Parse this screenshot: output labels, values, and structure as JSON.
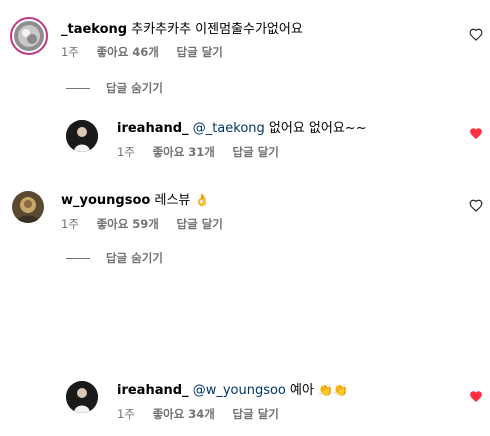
{
  "comments": [
    {
      "username": "_taekong",
      "text": "추카추카추 이젠멈출수가없어요",
      "time": "1주",
      "likes": "좋아요 46개",
      "reply": "답글 달기",
      "liked": false,
      "avatar_icon": "globe-avatar"
    },
    {
      "username": "ireahand_",
      "mention": "@_taekong",
      "text": "없어요 없어요~~",
      "time": "1주",
      "likes": "좋아요 31개",
      "reply": "답글 달기",
      "liked": true,
      "avatar_icon": "portrait-avatar"
    },
    {
      "username": "w_youngsoo",
      "text": "레스뷰",
      "emoji": "👌",
      "time": "1주",
      "likes": "좋아요 59개",
      "reply": "답글 달기",
      "liked": false,
      "avatar_icon": "person-avatar"
    },
    {
      "username": "ireahand_",
      "mention": "@w_youngsoo",
      "text": "예아",
      "emoji": "👏👏",
      "time": "1주",
      "likes": "좋아요 34개",
      "reply": "답글 달기",
      "liked": true,
      "avatar_icon": "portrait-avatar"
    }
  ],
  "toggles": [
    {
      "label": "답글 숨기기"
    },
    {
      "label": "답글 숨기기"
    }
  ],
  "colors": {
    "heart_liked": "#ff3040",
    "meta": "#737373",
    "mention": "#00376b"
  }
}
